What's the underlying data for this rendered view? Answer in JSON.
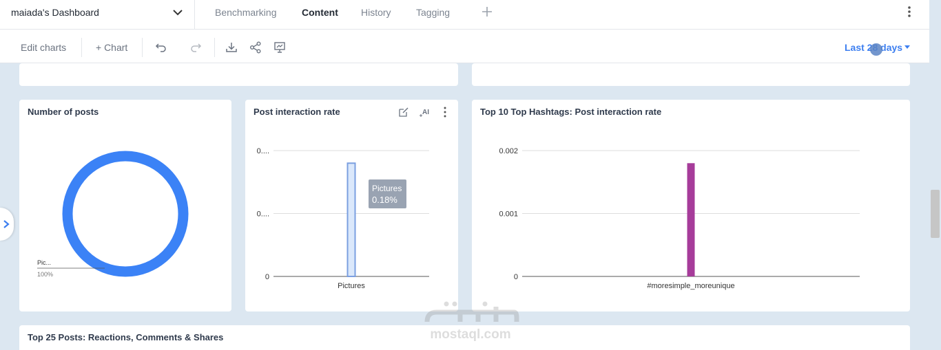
{
  "header": {
    "dashboard_title": "maiada's Dashboard",
    "tabs": [
      {
        "label": "Benchmarking"
      },
      {
        "label": "Content"
      },
      {
        "label": "History"
      },
      {
        "label": "Tagging"
      }
    ]
  },
  "toolbar": {
    "edit_charts": "Edit charts",
    "add_chart": "+ Chart",
    "date_range": "Last 28 days"
  },
  "cards": {
    "number_of_posts": {
      "title": "Number of posts",
      "chart_data": {
        "type": "pie",
        "slices": [
          {
            "label": "Pic...",
            "value": 100,
            "percent_label": "100%"
          }
        ],
        "color": "#3b82f6"
      }
    },
    "post_interaction_rate": {
      "title": "Post interaction rate",
      "tooltip": {
        "label": "Pictures",
        "value": "0.18%"
      },
      "chart_data": {
        "type": "bar",
        "categories": [
          "Pictures"
        ],
        "values": [
          0.0018
        ],
        "ytick_labels": [
          "0",
          "0....",
          "0...."
        ],
        "ylim": [
          0,
          0.002
        ],
        "color": "#dbe8fb",
        "stroke": "#7b9fe0"
      }
    },
    "top_hashtags": {
      "title": "Top 10 Top Hashtags: Post interaction rate",
      "chart_data": {
        "type": "bar",
        "categories": [
          "#moresimple_moreunique"
        ],
        "values": [
          0.0018
        ],
        "ytick_labels": [
          "0",
          "0.001",
          "0.002"
        ],
        "ylim": [
          0,
          0.002
        ],
        "color": "#a63c9a"
      }
    },
    "top_posts": {
      "title": "Top 25 Posts: Reactions, Comments & Shares"
    }
  },
  "watermark": {
    "text": "mostaql.com"
  }
}
